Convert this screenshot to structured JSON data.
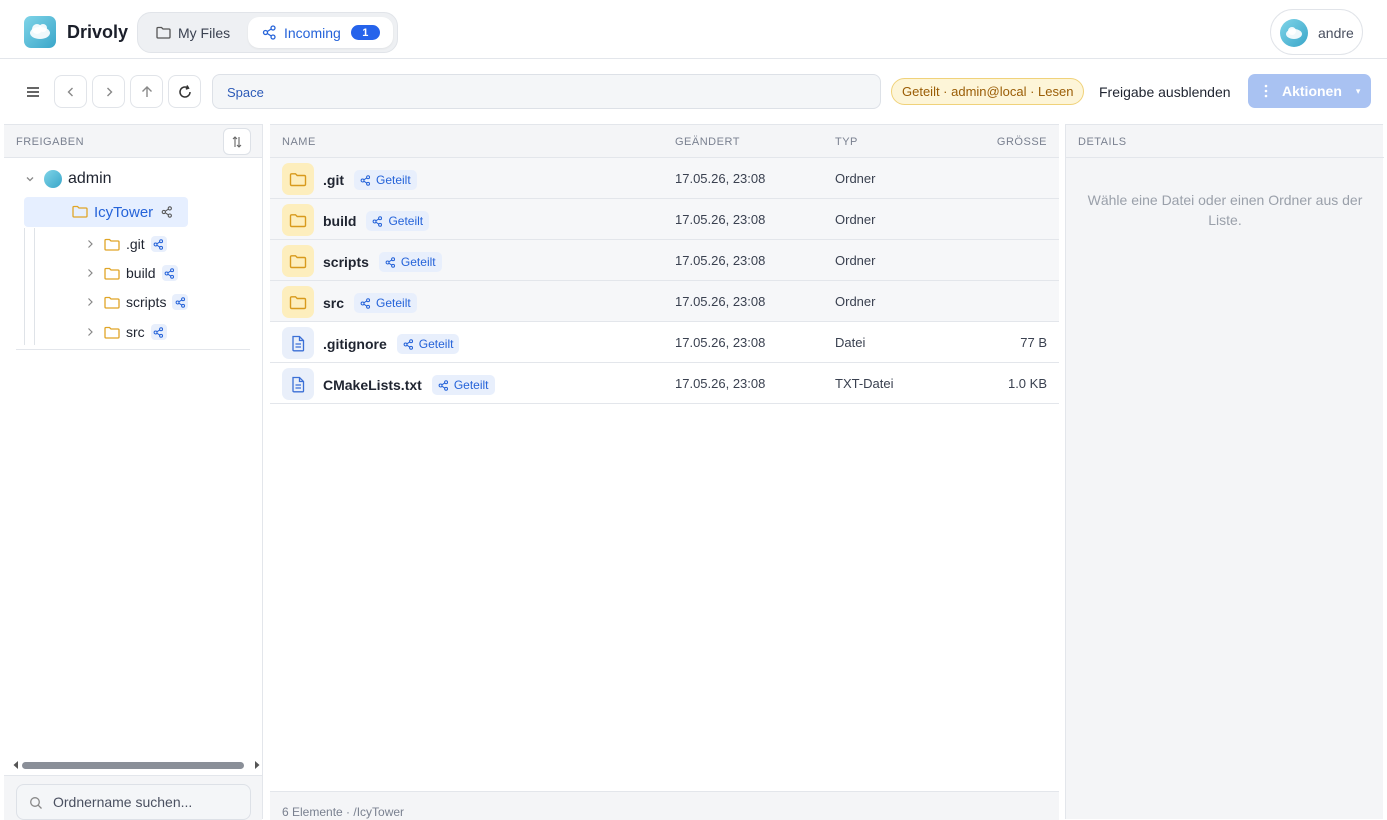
{
  "header": {
    "brand": "Drivoly",
    "tabs": [
      {
        "label": "My Files"
      },
      {
        "label": "Incoming",
        "badge": "1"
      }
    ],
    "user": "andre"
  },
  "toolbar": {
    "path_segment": "Space",
    "share_info": "Geteilt · admin@local · Lesen",
    "hide_share": "Freigabe ausblenden",
    "actions": "Aktionen"
  },
  "sidebar": {
    "title": "FREIGABEN",
    "root": "admin",
    "selected": "IcyTower",
    "children": [
      ".git",
      "build",
      "scripts",
      "src"
    ],
    "search_placeholder": "Ordnername suchen..."
  },
  "filelist": {
    "headers": {
      "name": "NAME",
      "changed": "GEÄNDERT",
      "type": "TYP",
      "size": "GRÖSSE"
    },
    "shared_label": "Geteilt",
    "rows": [
      {
        "name": ".git",
        "date": "17.05.26, 23:08",
        "type": "Ordner",
        "size": "",
        "kind": "folder"
      },
      {
        "name": "build",
        "date": "17.05.26, 23:08",
        "type": "Ordner",
        "size": "",
        "kind": "folder"
      },
      {
        "name": "scripts",
        "date": "17.05.26, 23:08",
        "type": "Ordner",
        "size": "",
        "kind": "folder"
      },
      {
        "name": "src",
        "date": "17.05.26, 23:08",
        "type": "Ordner",
        "size": "",
        "kind": "folder"
      },
      {
        "name": ".gitignore",
        "date": "17.05.26, 23:08",
        "type": "Datei",
        "size": "77 B",
        "kind": "file"
      },
      {
        "name": "CMakeLists.txt",
        "date": "17.05.26, 23:08",
        "type": "TXT-Datei",
        "size": "1.0 KB",
        "kind": "file"
      }
    ],
    "footer": "6 Elemente · /IcyTower"
  },
  "details": {
    "title": "DETAILS",
    "empty": "Wähle eine Datei oder einen Ordner aus der Liste."
  },
  "colors": {
    "accent": "#2563eb",
    "folder": "#e0a526",
    "selected_bg": "#e6efff"
  }
}
